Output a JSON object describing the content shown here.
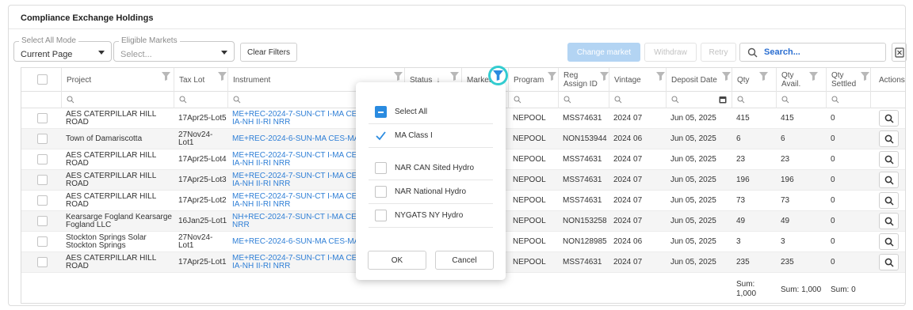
{
  "title": "Compliance Exchange Holdings",
  "toolbar": {
    "select_all_mode_label": "Select All Mode",
    "select_all_mode_value": "Current Page",
    "eligible_markets_label": "Eligible Markets",
    "eligible_markets_placeholder": "Select...",
    "clear_filters": "Clear Filters",
    "change_market": "Change market",
    "withdraw": "Withdraw",
    "retry": "Retry",
    "search_placeholder": "Search..."
  },
  "columns": [
    "Project",
    "Tax Lot",
    "Instrument",
    "Status",
    "Market",
    "Program",
    "Reg Assign ID",
    "Vintage",
    "Deposit Date",
    "Qty",
    "Qty Avail.",
    "Qty Settled",
    "Actions"
  ],
  "rows": [
    {
      "project": "AES CATERPILLAR HILL ROAD",
      "taxlot": "17Apr25-Lot5",
      "instrument": "ME+REC-2024-7-SUN-CT I-MA CES ME IA-NH II-RI NRR",
      "program": "NEPOOL",
      "reg": "MSS74631",
      "vintage": "2024 07",
      "deposit": "Jun 05, 2025",
      "qty": "415",
      "avail": "415",
      "settled": "0"
    },
    {
      "project": "Town of Damariscotta",
      "taxlot": "27Nov24-Lot1",
      "instrument": "ME+REC-2024-6-SUN-MA CES-MA ME II",
      "program": "NEPOOL",
      "reg": "NON153944",
      "vintage": "2024 06",
      "deposit": "Jun 05, 2025",
      "qty": "6",
      "avail": "6",
      "settled": "0"
    },
    {
      "project": "AES CATERPILLAR HILL ROAD",
      "taxlot": "17Apr25-Lot4",
      "instrument": "ME+REC-2024-7-SUN-CT I-MA CES ME IA-NH II-RI NRR",
      "program": "NEPOOL",
      "reg": "MSS74631",
      "vintage": "2024 07",
      "deposit": "Jun 05, 2025",
      "qty": "23",
      "avail": "23",
      "settled": "0"
    },
    {
      "project": "AES CATERPILLAR HILL ROAD",
      "taxlot": "17Apr25-Lot3",
      "instrument": "ME+REC-2024-7-SUN-CT I-MA CES ME IA-NH II-RI NRR",
      "program": "NEPOOL",
      "reg": "MSS74631",
      "vintage": "2024 07",
      "deposit": "Jun 05, 2025",
      "qty": "196",
      "avail": "196",
      "settled": "0"
    },
    {
      "project": "AES CATERPILLAR HILL ROAD",
      "taxlot": "17Apr25-Lot2",
      "instrument": "ME+REC-2024-7-SUN-CT I-MA CES ME IA-NH II-RI NRR",
      "program": "NEPOOL",
      "reg": "MSS74631",
      "vintage": "2024 07",
      "deposit": "Jun 05, 2025",
      "qty": "73",
      "avail": "73",
      "settled": "0"
    },
    {
      "project": "Kearsarge Fogland Kearsarge Fogland LLC",
      "taxlot": "16Jan25-Lot1",
      "instrument": "NH+REC-2024-7-SUN-CT I-MA CES RI NRR",
      "program": "NEPOOL",
      "reg": "NON153258",
      "vintage": "2024 07",
      "deposit": "Jun 05, 2025",
      "qty": "49",
      "avail": "49",
      "settled": "0"
    },
    {
      "project": "Stockton Springs Solar Stockton Springs",
      "taxlot": "27Nov24-Lot1",
      "instrument": "ME+REC-2024-6-SUN-MA CES-MA ME II",
      "program": "NEPOOL",
      "reg": "NON128985",
      "vintage": "2024 06",
      "deposit": "Jun 05, 2025",
      "qty": "3",
      "avail": "3",
      "settled": "0"
    },
    {
      "project": "AES CATERPILLAR HILL ROAD",
      "taxlot": "17Apr25-Lot1",
      "instrument": "ME+REC-2024-7-SUN-CT I-MA CES ME IA-NH II-RI NRR",
      "program": "NEPOOL",
      "reg": "MSS74631",
      "vintage": "2024 07",
      "deposit": "Jun 05, 2025",
      "qty": "235",
      "avail": "235",
      "settled": "0"
    }
  ],
  "sums": {
    "qty": "Sum: 1,000",
    "avail": "Sum: 1,000",
    "settled": "Sum: 0"
  },
  "popup": {
    "options": [
      {
        "label": "Select All",
        "state": "partial"
      },
      {
        "label": "MA Class I",
        "state": "checked"
      },
      {
        "label": "NAR CAN Sited Hydro",
        "state": "unchecked"
      },
      {
        "label": "NAR National Hydro",
        "state": "unchecked"
      },
      {
        "label": "NYGATS NY Hydro",
        "state": "unchecked"
      }
    ],
    "ok": "OK",
    "cancel": "Cancel"
  },
  "colors": {
    "accent": "#2f7fd6",
    "highlight": "#33ccd0",
    "primary_disabled": "#b3d4f3"
  }
}
